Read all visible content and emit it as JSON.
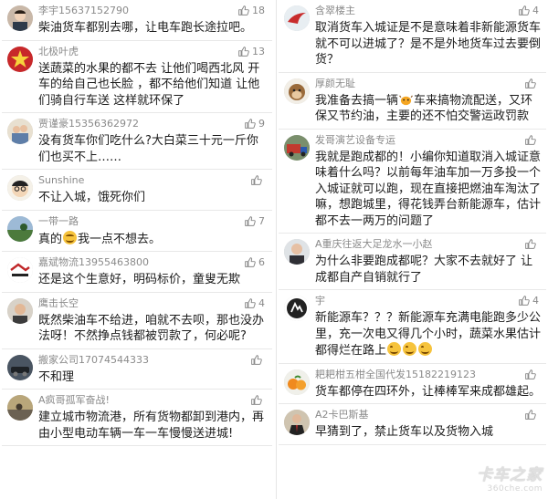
{
  "colors": {
    "name": "#8a8a8a",
    "text": "#1b1b1b",
    "divider": "#e8e8e8",
    "like": "#8a8a8a"
  },
  "left_comments": [
    {
      "name": "李宇15637152790",
      "likes": "18",
      "text": "柴油货车都别去哪，让电车跑长途拉吧。",
      "avatar": "avatar-person"
    },
    {
      "name": "北极叶虎",
      "likes": "13",
      "text": "送蔬菜的水果的都不去 让他们喝西北风 开车的给自己也长脸 ，都不给他们知道 让他们骑自行车送 这样就环保了",
      "avatar": "avatar-star"
    },
    {
      "name": "贾谨豪15356362972",
      "likes": "9",
      "text": "没有货车你们吃什么?大白菜三十元一斤你们也买不上……",
      "avatar": "avatar-family"
    },
    {
      "name": "Sunshine",
      "likes": "",
      "text": "不让入城，饿死你们",
      "avatar": "avatar-cartoon"
    },
    {
      "name": "一带一路",
      "likes": "7",
      "text_before": "真的",
      "text_after": "我一点不想去。",
      "emoji": "smile-emoji",
      "avatar": "avatar-landscape"
    },
    {
      "name": "嘉斌物流13955463800",
      "likes": "6",
      "text": "还是这个生意好，明码标价，童叟无欺",
      "avatar": "avatar-logo"
    },
    {
      "name": "鹰击长空",
      "likes": "4",
      "text": "既然柴油车不给进，咱就不去呗，那也没办法呀！不然挣点钱都被罚款了，何必呢?",
      "avatar": "avatar-man"
    },
    {
      "name": "搬家公司17074544333",
      "likes": "",
      "text": "不和理",
      "avatar": "avatar-car"
    },
    {
      "name": "A疯哥孤军奋战!",
      "likes": "",
      "text": "建立城市物流港，所有货物都卸到港内，再由小型电动车辆一车一车慢慢送进城!",
      "avatar": "avatar-street"
    }
  ],
  "right_comments": [
    {
      "name": "含翠楼主",
      "likes": "4",
      "text": "取消货车入城证是不是意味着非新能源货车就不可以进城了？是不是外地货车过去要倒货？",
      "avatar": "avatar-bird"
    },
    {
      "name": "厚颜无耻",
      "likes": "",
      "text_before": "我准备去搞一辆",
      "text_after": "车来搞物流配送，又环保又节约油，主要的还不怕交警运政罚款",
      "inline_icon": "cow-icon",
      "avatar": "avatar-monkey"
    },
    {
      "name": "发哥演艺设备专运",
      "likes": "",
      "text": "我就是跑成都的！小编你知道取消入城证意味着什么吗？以前每年油车加一万多投一个入城证就可以跑，现在直接把燃油车淘汰了嘛，想跑城里，得花钱弄台新能源车，估计都不去一两万的问题了",
      "avatar": "avatar-truck"
    },
    {
      "name": "A重庆往返大足龙水一小赵",
      "likes": "",
      "text": "为什么非要跑成都呢？大家不去就好了 让成都自产自销就行了",
      "avatar": "avatar-portrait"
    },
    {
      "name": "宇",
      "likes": "4",
      "text": "新能源车？？？新能源车充满电能跑多少公里，充一次电又得几个小时，蔬菜水果估计都得烂在路上",
      "emojis": "grin-emoji",
      "avatar": "avatar-logo-dark"
    },
    {
      "name": "耙耙柑五柑全国代发15182219123",
      "likes": "",
      "text": "货车都停在四环外，让棒棒军来成都雄起。",
      "avatar": "avatar-orange"
    },
    {
      "name": "A2卡巴斯基",
      "likes": "",
      "text": "早猜到了，禁止货车以及货物入城",
      "avatar": "avatar-suit"
    }
  ],
  "watermark": {
    "main": "卡车之家",
    "sub": "360che.com"
  }
}
